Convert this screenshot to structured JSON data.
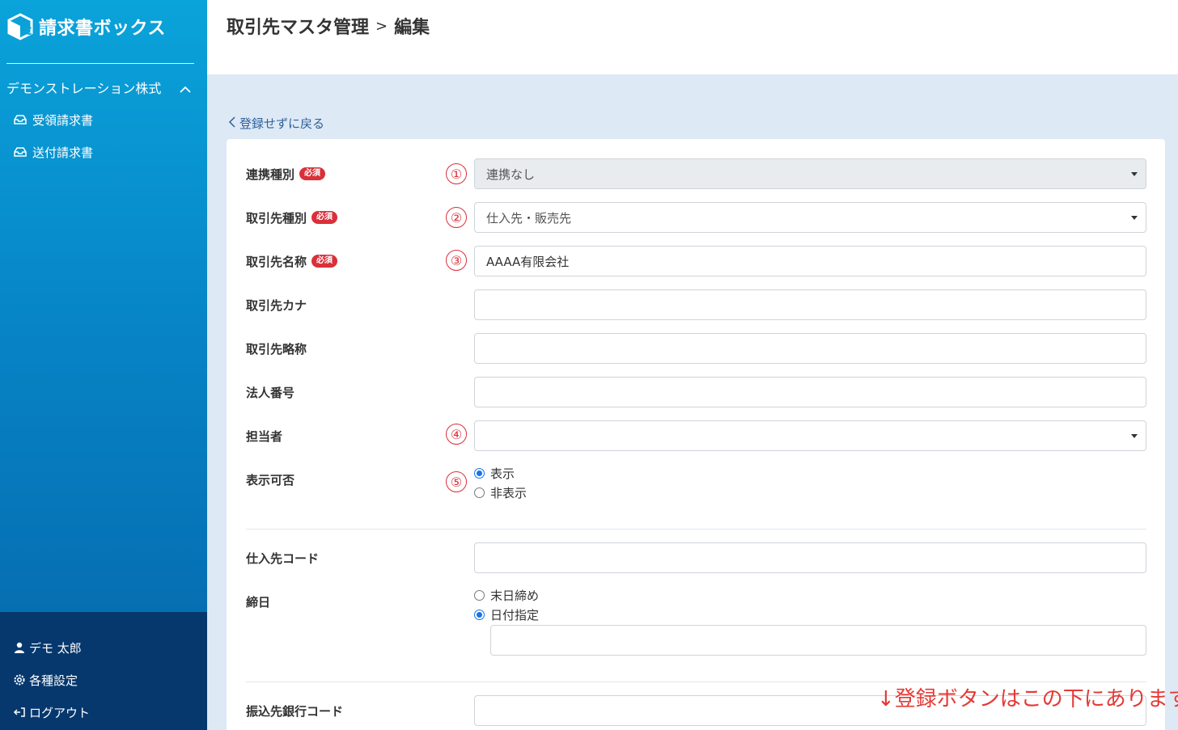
{
  "app": {
    "name": "請求書ボックス"
  },
  "sidebar": {
    "company": "デモンストレーション株式",
    "items": [
      {
        "label": "受領請求書",
        "icon": "inbox-icon"
      },
      {
        "label": "送付請求書",
        "icon": "inbox-icon"
      }
    ],
    "bottom": [
      {
        "label": "デモ 太郎",
        "icon": "user-icon"
      },
      {
        "label": "各種設定",
        "icon": "gear-icon"
      },
      {
        "label": "ログアウト",
        "icon": "logout-icon"
      }
    ]
  },
  "header": {
    "breadcrumb_parent": "取引先マスタ管理",
    "separator": ">",
    "breadcrumb_current": "編集"
  },
  "back_link": "登録せずに戻る",
  "form": {
    "required_badge": "必須",
    "markers": [
      "①",
      "②",
      "③",
      "④",
      "⑤"
    ],
    "fields": {
      "integration_type": {
        "label": "連携種別",
        "value": "連携なし"
      },
      "partner_type": {
        "label": "取引先種別",
        "value": "仕入先・販売先"
      },
      "partner_name": {
        "label": "取引先名称",
        "value": "AAAA有限会社"
      },
      "partner_kana": {
        "label": "取引先カナ",
        "value": ""
      },
      "partner_short": {
        "label": "取引先略称",
        "value": ""
      },
      "corporate_number": {
        "label": "法人番号",
        "value": ""
      },
      "person_in_charge": {
        "label": "担当者",
        "value": ""
      },
      "visibility": {
        "label": "表示可否",
        "options": [
          "表示",
          "非表示"
        ],
        "selected": "表示"
      },
      "supplier_code": {
        "label": "仕入先コード",
        "value": ""
      },
      "closing_day": {
        "label": "締日",
        "options": [
          "末日締め",
          "日付指定"
        ],
        "selected": "日付指定",
        "date_value": ""
      },
      "bank_code": {
        "label": "振込先銀行コード",
        "value": ""
      }
    }
  },
  "annotation": "↓登録ボタンはこの下にあります",
  "colors": {
    "sidebar_top": "#0aa3da",
    "sidebar_bottom": "#06386e",
    "required": "#d9303a",
    "link": "#2d5f9a",
    "annotation": "#e53935"
  }
}
